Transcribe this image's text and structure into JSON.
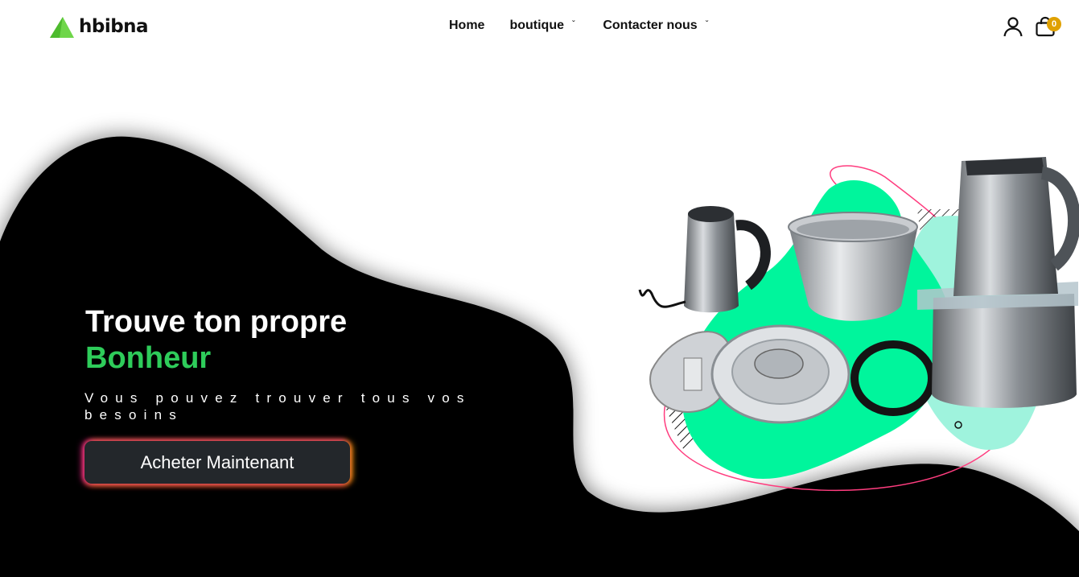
{
  "brand": {
    "name": "hbibna",
    "logo_color": "#6fd64a"
  },
  "nav": {
    "home": "Home",
    "boutique": "boutique",
    "contact": "Contacter nous"
  },
  "header_icons": {
    "user": "user-icon",
    "cart": "shopping-bag-icon",
    "cart_count": "0",
    "badge_color": "#e0a100"
  },
  "hero": {
    "title": "Trouve ton propre",
    "accent": "Bonheur",
    "subtitle": "Vous pouvez trouver tous vos besoins",
    "cta": "Acheter Maintenant",
    "accent_color": "#2ecc5a",
    "background_color": "#000000",
    "splash_color": "#00f5a0",
    "product_image": "kitchen-appliances-image"
  }
}
